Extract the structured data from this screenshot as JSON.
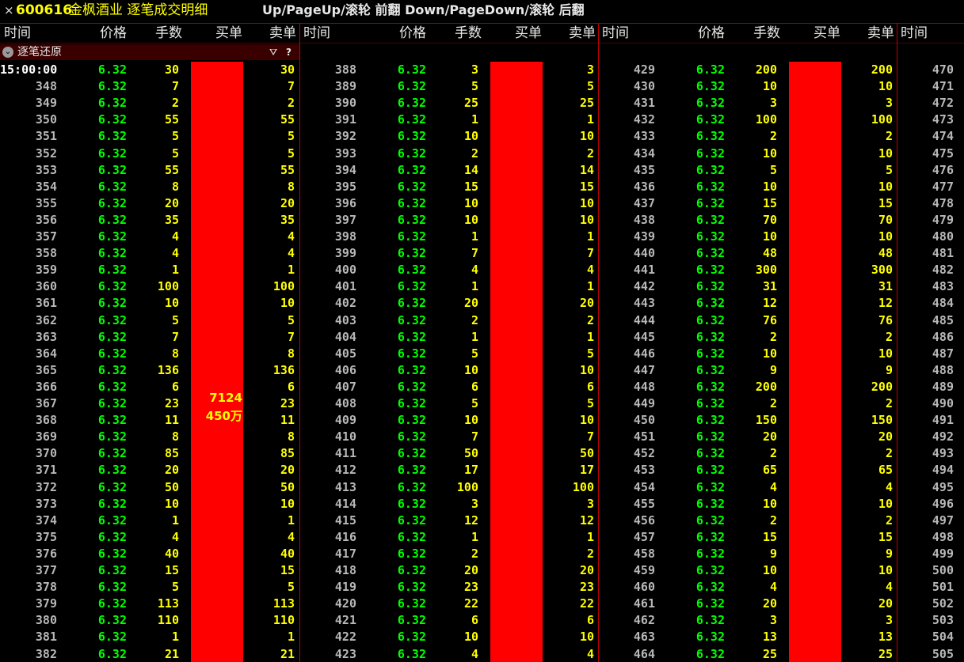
{
  "title": {
    "close_glyph": "×",
    "code": "600616",
    "name": "金枫酒业 逐笔成交明细",
    "hint": "Up/PageUp/滚轮 前翻 Down/PageDown/滚轮 后翻"
  },
  "headers": {
    "time": "时间",
    "price": "价格",
    "volume": "手数",
    "buy": "买单",
    "sell": "卖单"
  },
  "filter": {
    "label": "逐笔还原",
    "collapse_icon": "chevron-down-icon",
    "funnel_glyph": "⛛",
    "help_glyph": "?"
  },
  "colors": {
    "background": "#000000",
    "price": "#00ff00",
    "volume": "#ffff00",
    "time": "#b8b8b8",
    "buy_bar": "#ff0000",
    "divider": "#c00000"
  },
  "buy_bar_label": {
    "count": "7124",
    "amount": "450万"
  },
  "columns": [
    {
      "rows": [
        [
          "15:00:00",
          "6.32",
          "30",
          "30"
        ],
        [
          "348",
          "6.32",
          "7",
          "7"
        ],
        [
          "349",
          "6.32",
          "2",
          "2"
        ],
        [
          "350",
          "6.32",
          "55",
          "55"
        ],
        [
          "351",
          "6.32",
          "5",
          "5"
        ],
        [
          "352",
          "6.32",
          "5",
          "5"
        ],
        [
          "353",
          "6.32",
          "55",
          "55"
        ],
        [
          "354",
          "6.32",
          "8",
          "8"
        ],
        [
          "355",
          "6.32",
          "20",
          "20"
        ],
        [
          "356",
          "6.32",
          "35",
          "35"
        ],
        [
          "357",
          "6.32",
          "4",
          "4"
        ],
        [
          "358",
          "6.32",
          "4",
          "4"
        ],
        [
          "359",
          "6.32",
          "1",
          "1"
        ],
        [
          "360",
          "6.32",
          "100",
          "100"
        ],
        [
          "361",
          "6.32",
          "10",
          "10"
        ],
        [
          "362",
          "6.32",
          "5",
          "5"
        ],
        [
          "363",
          "6.32",
          "7",
          "7"
        ],
        [
          "364",
          "6.32",
          "8",
          "8"
        ],
        [
          "365",
          "6.32",
          "136",
          "136"
        ],
        [
          "366",
          "6.32",
          "6",
          "6"
        ],
        [
          "367",
          "6.32",
          "23",
          "23"
        ],
        [
          "368",
          "6.32",
          "11",
          "11"
        ],
        [
          "369",
          "6.32",
          "8",
          "8"
        ],
        [
          "370",
          "6.32",
          "85",
          "85"
        ],
        [
          "371",
          "6.32",
          "20",
          "20"
        ],
        [
          "372",
          "6.32",
          "50",
          "50"
        ],
        [
          "373",
          "6.32",
          "10",
          "10"
        ],
        [
          "374",
          "6.32",
          "1",
          "1"
        ],
        [
          "375",
          "6.32",
          "4",
          "4"
        ],
        [
          "376",
          "6.32",
          "40",
          "40"
        ],
        [
          "377",
          "6.32",
          "15",
          "15"
        ],
        [
          "378",
          "6.32",
          "5",
          "5"
        ],
        [
          "379",
          "6.32",
          "113",
          "113"
        ],
        [
          "380",
          "6.32",
          "110",
          "110"
        ],
        [
          "381",
          "6.32",
          "1",
          "1"
        ],
        [
          "382",
          "6.32",
          "21",
          "21"
        ]
      ]
    },
    {
      "rows": [
        [
          "388",
          "6.32",
          "3",
          "3"
        ],
        [
          "389",
          "6.32",
          "5",
          "5"
        ],
        [
          "390",
          "6.32",
          "25",
          "25"
        ],
        [
          "391",
          "6.32",
          "1",
          "1"
        ],
        [
          "392",
          "6.32",
          "10",
          "10"
        ],
        [
          "393",
          "6.32",
          "2",
          "2"
        ],
        [
          "394",
          "6.32",
          "14",
          "14"
        ],
        [
          "395",
          "6.32",
          "15",
          "15"
        ],
        [
          "396",
          "6.32",
          "10",
          "10"
        ],
        [
          "397",
          "6.32",
          "10",
          "10"
        ],
        [
          "398",
          "6.32",
          "1",
          "1"
        ],
        [
          "399",
          "6.32",
          "7",
          "7"
        ],
        [
          "400",
          "6.32",
          "4",
          "4"
        ],
        [
          "401",
          "6.32",
          "1",
          "1"
        ],
        [
          "402",
          "6.32",
          "20",
          "20"
        ],
        [
          "403",
          "6.32",
          "2",
          "2"
        ],
        [
          "404",
          "6.32",
          "1",
          "1"
        ],
        [
          "405",
          "6.32",
          "5",
          "5"
        ],
        [
          "406",
          "6.32",
          "10",
          "10"
        ],
        [
          "407",
          "6.32",
          "6",
          "6"
        ],
        [
          "408",
          "6.32",
          "5",
          "5"
        ],
        [
          "409",
          "6.32",
          "10",
          "10"
        ],
        [
          "410",
          "6.32",
          "7",
          "7"
        ],
        [
          "411",
          "6.32",
          "50",
          "50"
        ],
        [
          "412",
          "6.32",
          "17",
          "17"
        ],
        [
          "413",
          "6.32",
          "100",
          "100"
        ],
        [
          "414",
          "6.32",
          "3",
          "3"
        ],
        [
          "415",
          "6.32",
          "12",
          "12"
        ],
        [
          "416",
          "6.32",
          "1",
          "1"
        ],
        [
          "417",
          "6.32",
          "2",
          "2"
        ],
        [
          "418",
          "6.32",
          "20",
          "20"
        ],
        [
          "419",
          "6.32",
          "23",
          "23"
        ],
        [
          "420",
          "6.32",
          "22",
          "22"
        ],
        [
          "421",
          "6.32",
          "6",
          "6"
        ],
        [
          "422",
          "6.32",
          "10",
          "10"
        ],
        [
          "423",
          "6.32",
          "4",
          "4"
        ]
      ]
    },
    {
      "rows": [
        [
          "429",
          "6.32",
          "200",
          "200"
        ],
        [
          "430",
          "6.32",
          "10",
          "10"
        ],
        [
          "431",
          "6.32",
          "3",
          "3"
        ],
        [
          "432",
          "6.32",
          "100",
          "100"
        ],
        [
          "433",
          "6.32",
          "2",
          "2"
        ],
        [
          "434",
          "6.32",
          "10",
          "10"
        ],
        [
          "435",
          "6.32",
          "5",
          "5"
        ],
        [
          "436",
          "6.32",
          "10",
          "10"
        ],
        [
          "437",
          "6.32",
          "15",
          "15"
        ],
        [
          "438",
          "6.32",
          "70",
          "70"
        ],
        [
          "439",
          "6.32",
          "10",
          "10"
        ],
        [
          "440",
          "6.32",
          "48",
          "48"
        ],
        [
          "441",
          "6.32",
          "300",
          "300"
        ],
        [
          "442",
          "6.32",
          "31",
          "31"
        ],
        [
          "443",
          "6.32",
          "12",
          "12"
        ],
        [
          "444",
          "6.32",
          "76",
          "76"
        ],
        [
          "445",
          "6.32",
          "2",
          "2"
        ],
        [
          "446",
          "6.32",
          "10",
          "10"
        ],
        [
          "447",
          "6.32",
          "9",
          "9"
        ],
        [
          "448",
          "6.32",
          "200",
          "200"
        ],
        [
          "449",
          "6.32",
          "2",
          "2"
        ],
        [
          "450",
          "6.32",
          "150",
          "150"
        ],
        [
          "451",
          "6.32",
          "20",
          "20"
        ],
        [
          "452",
          "6.32",
          "2",
          "2"
        ],
        [
          "453",
          "6.32",
          "65",
          "65"
        ],
        [
          "454",
          "6.32",
          "4",
          "4"
        ],
        [
          "455",
          "6.32",
          "10",
          "10"
        ],
        [
          "456",
          "6.32",
          "2",
          "2"
        ],
        [
          "457",
          "6.32",
          "15",
          "15"
        ],
        [
          "458",
          "6.32",
          "9",
          "9"
        ],
        [
          "459",
          "6.32",
          "10",
          "10"
        ],
        [
          "460",
          "6.32",
          "4",
          "4"
        ],
        [
          "461",
          "6.32",
          "20",
          "20"
        ],
        [
          "462",
          "6.32",
          "3",
          "3"
        ],
        [
          "463",
          "6.32",
          "13",
          "13"
        ],
        [
          "464",
          "6.32",
          "25",
          "25"
        ]
      ]
    },
    {
      "rows": [
        [
          "470"
        ],
        [
          "471"
        ],
        [
          "472"
        ],
        [
          "473"
        ],
        [
          "474"
        ],
        [
          "475"
        ],
        [
          "476"
        ],
        [
          "477"
        ],
        [
          "478"
        ],
        [
          "479"
        ],
        [
          "480"
        ],
        [
          "481"
        ],
        [
          "482"
        ],
        [
          "483"
        ],
        [
          "484"
        ],
        [
          "485"
        ],
        [
          "486"
        ],
        [
          "487"
        ],
        [
          "488"
        ],
        [
          "489"
        ],
        [
          "490"
        ],
        [
          "491"
        ],
        [
          "492"
        ],
        [
          "493"
        ],
        [
          "494"
        ],
        [
          "495"
        ],
        [
          "496"
        ],
        [
          "497"
        ],
        [
          "498"
        ],
        [
          "499"
        ],
        [
          "500"
        ],
        [
          "501"
        ],
        [
          "502"
        ],
        [
          "503"
        ],
        [
          "504"
        ],
        [
          "505"
        ]
      ]
    }
  ]
}
